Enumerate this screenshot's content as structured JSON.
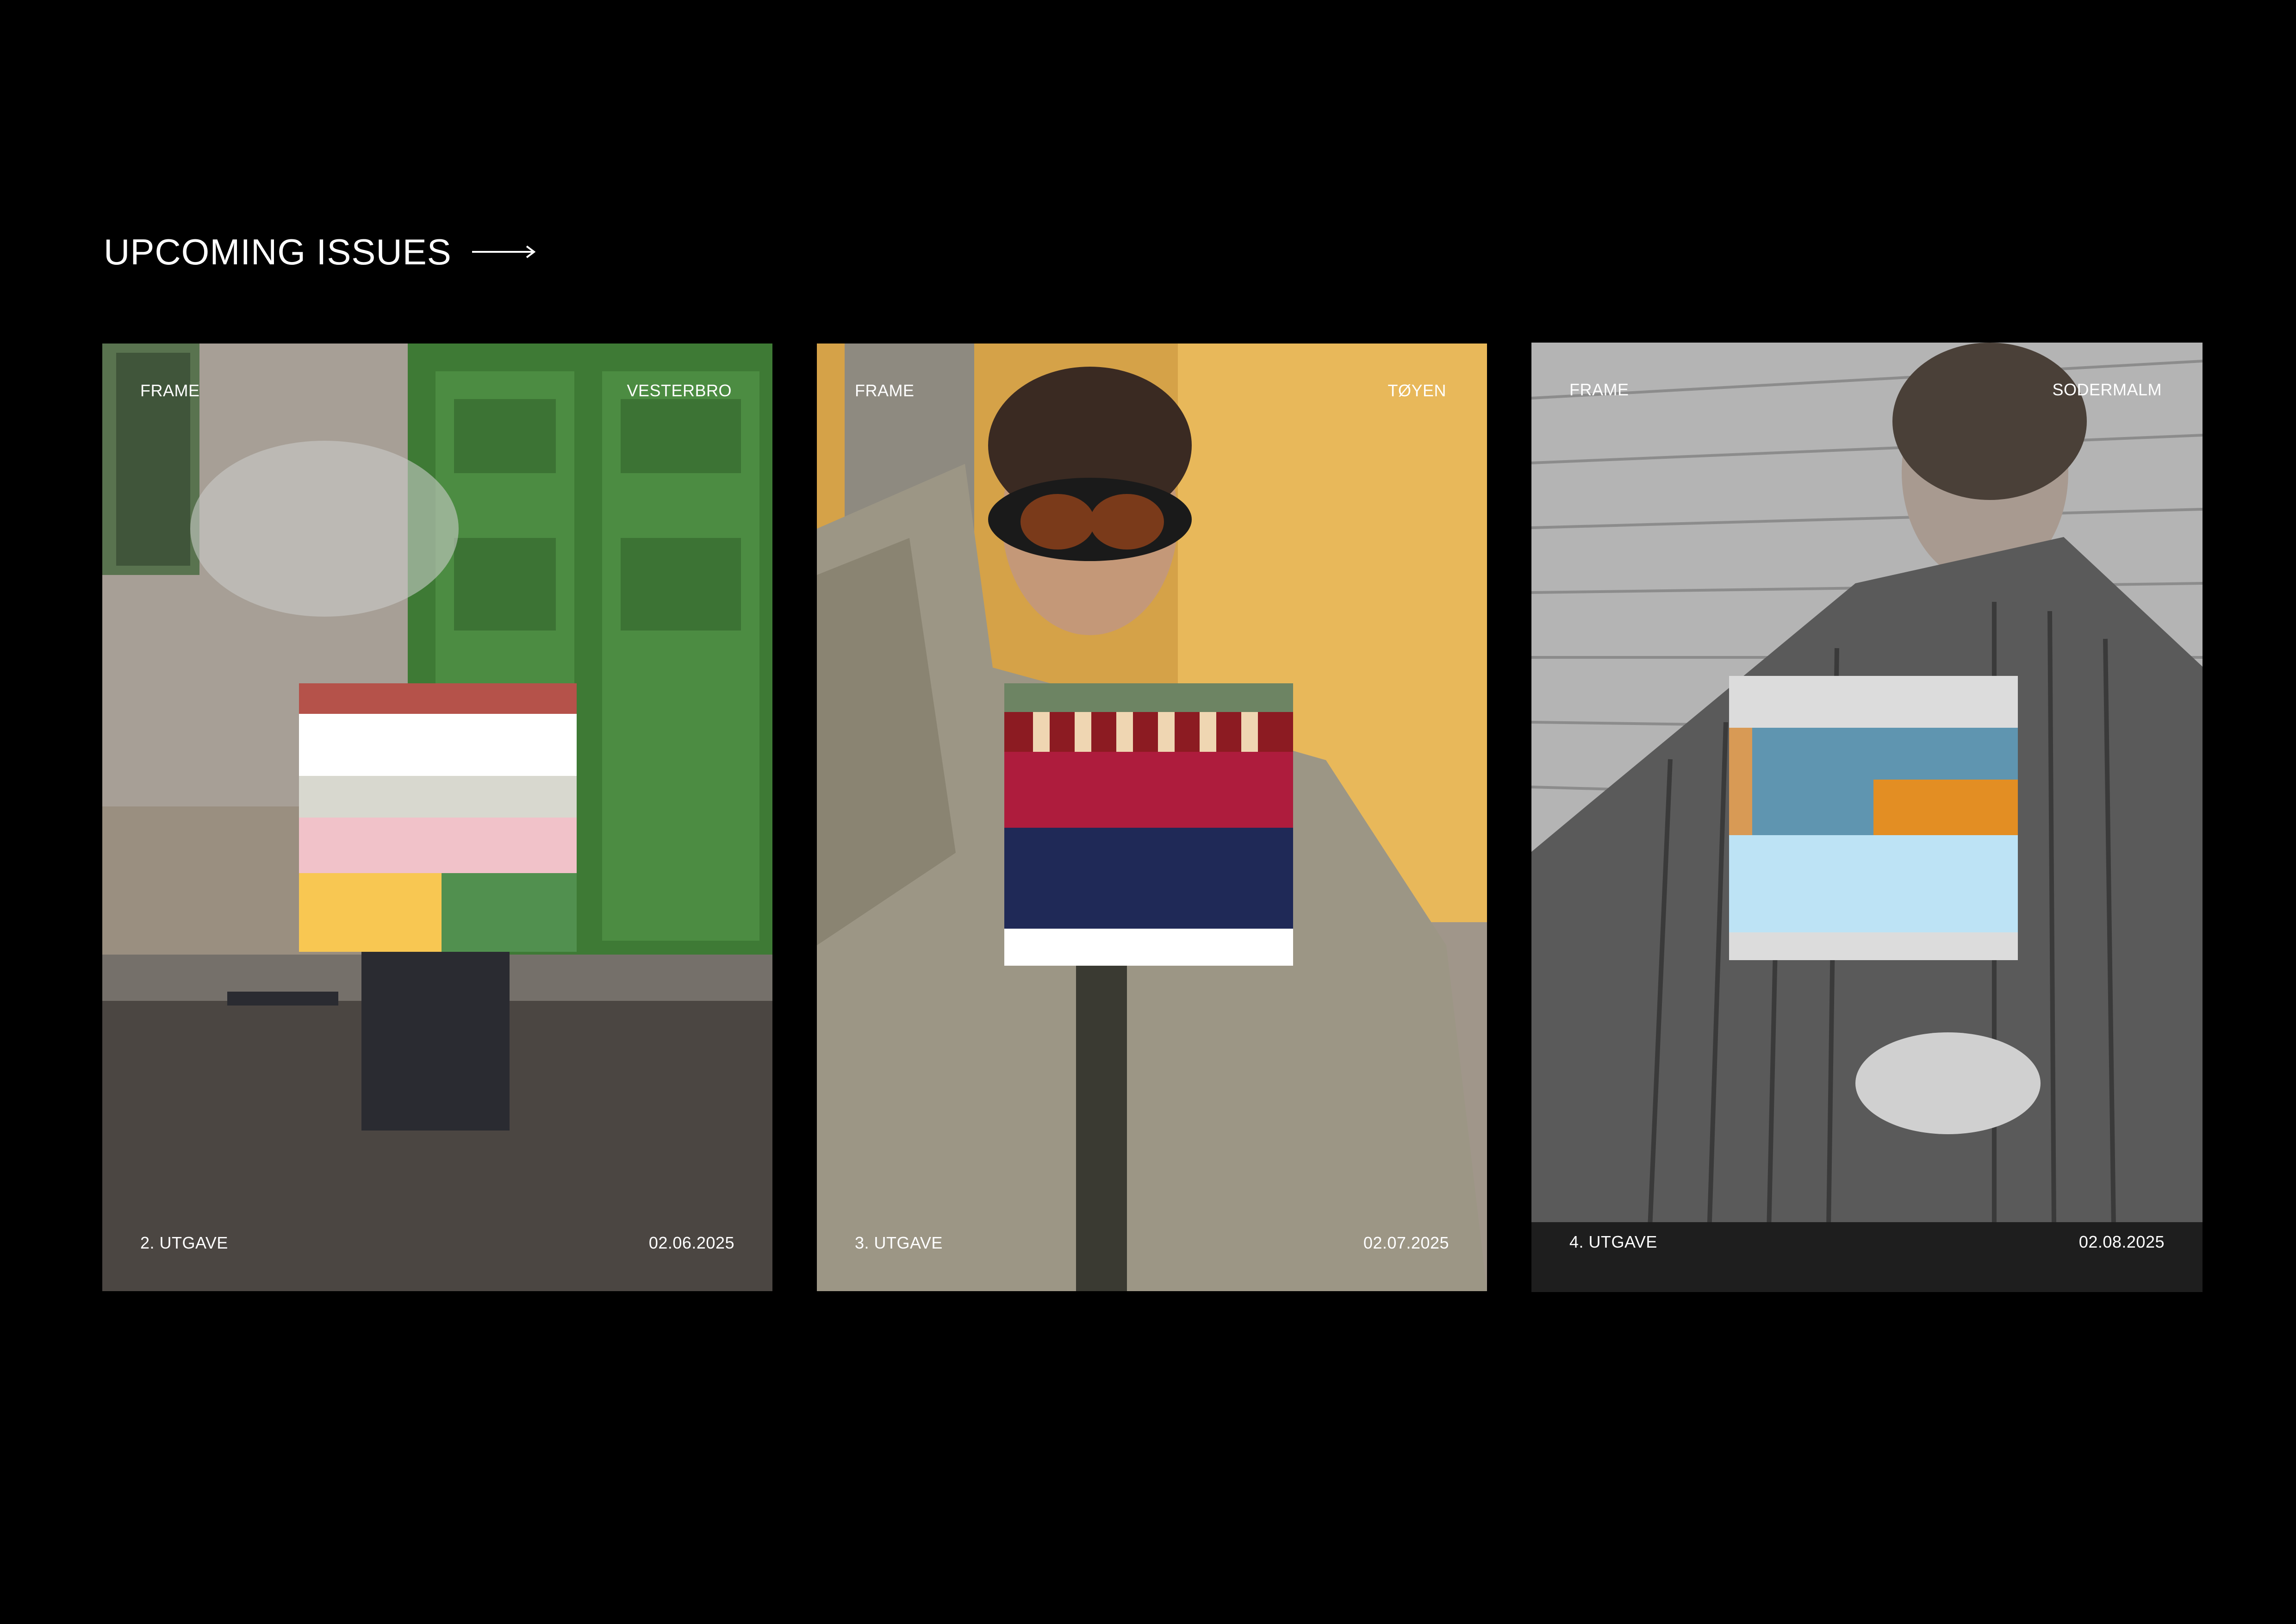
{
  "heading": {
    "title": "UPCOMING ISSUES",
    "arrow_icon": "arrow-right-icon"
  },
  "posters": [
    {
      "brand": "FRAME",
      "location": "VESTERBRO",
      "issue": "2. UTGAVE",
      "date": "02.06.2025",
      "palette": [
        "#b5524a",
        "#ffffff",
        "#d8d8cf",
        "#f1c2c9",
        "#f8c752",
        "#51904f"
      ]
    },
    {
      "brand": "FRAME",
      "location": "TØYEN",
      "issue": "3. UTGAVE",
      "date": "02.07.2025",
      "palette": [
        "#6d8463",
        "#8c1b22",
        "#efd6b2",
        "#ae1c3d",
        "#1f2957",
        "#ffffff"
      ]
    },
    {
      "brand": "FRAME",
      "location": "SODERMALM",
      "issue": "4. UTGAVE",
      "date": "02.08.2025",
      "palette": [
        "#dcdcdc",
        "#d89a55",
        "#5f95b0",
        "#e38e23",
        "#bde3f5"
      ]
    }
  ]
}
